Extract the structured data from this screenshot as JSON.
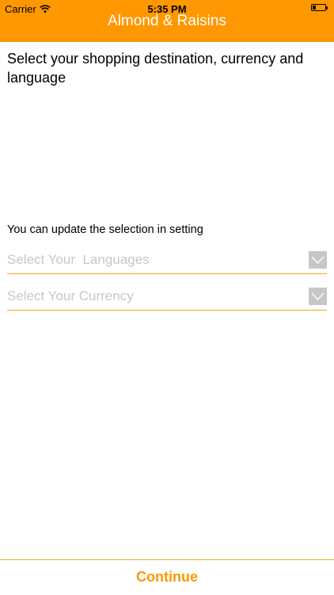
{
  "status_bar": {
    "carrier": "Carrier",
    "time": "5:35 PM",
    "wifi_icon": "wifi-icon",
    "battery_icon": "battery-icon"
  },
  "header": {
    "title": "Almond & Raisins",
    "background_color": "#FF9800"
  },
  "intro": {
    "text": "Select your shopping destination, currency and language"
  },
  "hint": {
    "text": "You can update the selection in setting"
  },
  "fields": {
    "language": {
      "placeholder": "Select Your  Languages",
      "icon": "chevron-down-icon"
    },
    "currency": {
      "placeholder": "Select Your Currency",
      "icon": "chevron-down-icon"
    }
  },
  "footer": {
    "continue_label": "Continue"
  },
  "colors": {
    "accent": "#FF9800",
    "underline": "#F5A623",
    "placeholder": "#C7C7CD"
  }
}
